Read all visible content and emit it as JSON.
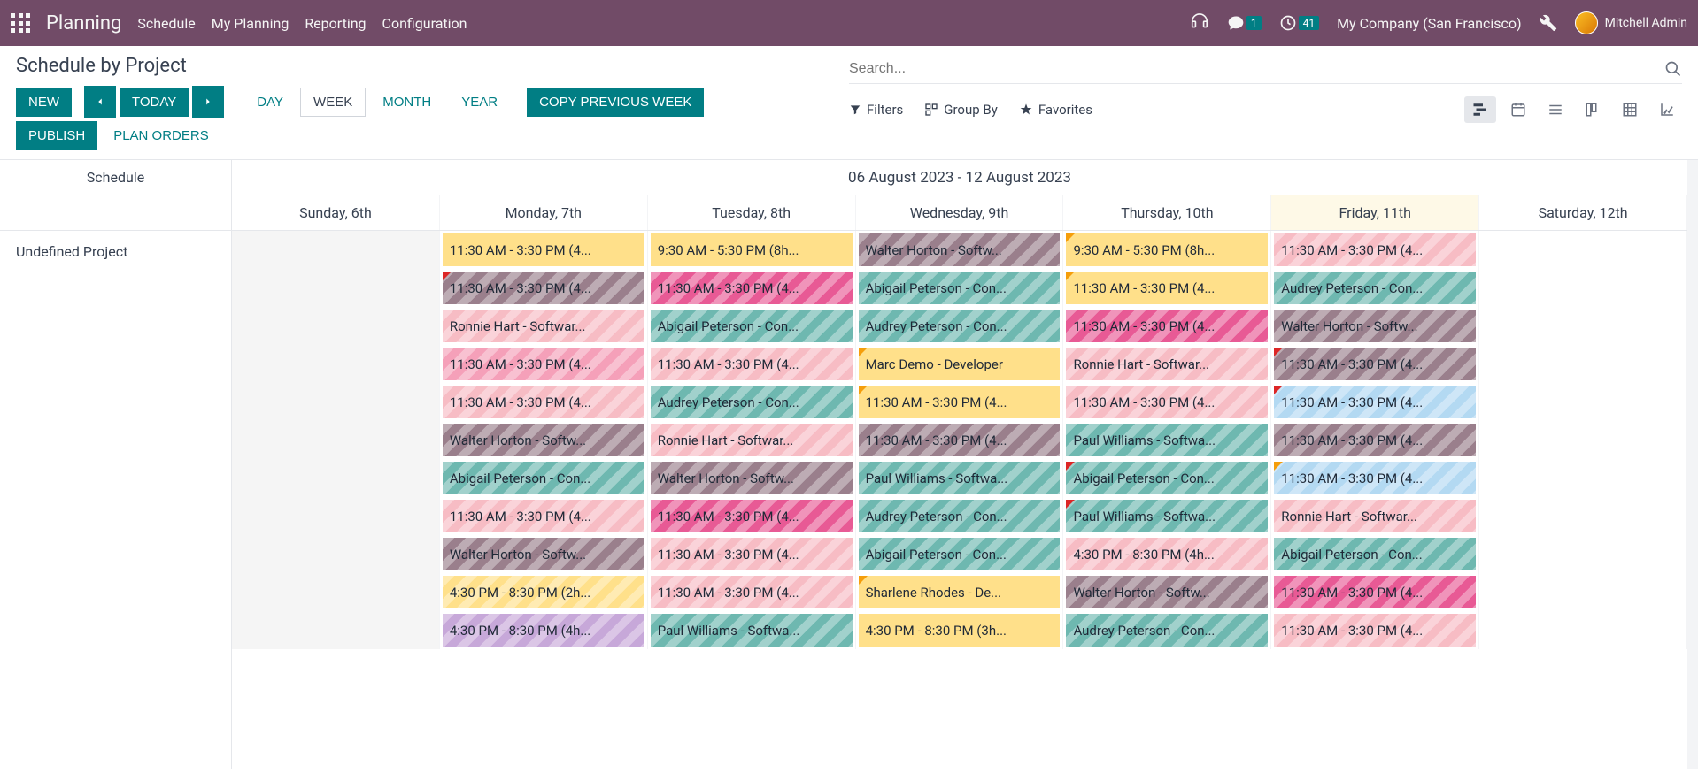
{
  "topbar": {
    "app_name": "Planning",
    "nav_items": [
      "Schedule",
      "My Planning",
      "Reporting",
      "Configuration"
    ],
    "badge_msg": "1",
    "badge_activity": "41",
    "company": "My Company (San Francisco)",
    "user_name": "Mitchell Admin"
  },
  "control": {
    "title": "Schedule by Project",
    "btn_new": "NEW",
    "btn_today": "TODAY",
    "btn_day": "DAY",
    "btn_week": "WEEK",
    "btn_month": "MONTH",
    "btn_year": "YEAR",
    "btn_copy": "COPY PREVIOUS WEEK",
    "btn_publish": "PUBLISH",
    "btn_plan": "PLAN ORDERS",
    "search_placeholder": "Search...",
    "filters": "Filters",
    "groupby": "Group By",
    "favorites": "Favorites"
  },
  "planner": {
    "side_header": "Schedule",
    "row_label": "Undefined Project",
    "date_range": "06 August 2023 - 12 August 2023",
    "days": [
      {
        "label": "Sunday, 6th",
        "past": true,
        "today": false,
        "slots": []
      },
      {
        "label": "Monday, 7th",
        "past": false,
        "today": false,
        "slots": [
          {
            "text": "11:30 AM - 3:30 PM (4...",
            "color": "c-yellow",
            "striped": false,
            "corner": null
          },
          {
            "text": "11:30 AM - 3:30 PM (4...",
            "color": "c-mauve",
            "striped": true,
            "corner": "corner-red"
          },
          {
            "text": "Ronnie Hart - Softwar...",
            "color": "c-pinklight",
            "striped": true,
            "corner": null
          },
          {
            "text": "11:30 AM - 3:30 PM (4...",
            "color": "c-pink",
            "striped": true,
            "corner": null
          },
          {
            "text": "11:30 AM - 3:30 PM (4...",
            "color": "c-pinklight",
            "striped": true,
            "corner": null
          },
          {
            "text": "Walter Horton - Softw...",
            "color": "c-mauve",
            "striped": true,
            "corner": null
          },
          {
            "text": "Abigail Peterson - Con...",
            "color": "c-teal",
            "striped": true,
            "corner": null
          },
          {
            "text": "11:30 AM - 3:30 PM (4...",
            "color": "c-pinklight",
            "striped": true,
            "corner": null
          },
          {
            "text": "Walter Horton - Softw...",
            "color": "c-mauve",
            "striped": true,
            "corner": null
          },
          {
            "text": "4:30 PM - 8:30 PM (2h...",
            "color": "c-yellow",
            "striped": true,
            "corner": null
          },
          {
            "text": "4:30 PM - 8:30 PM (4h...",
            "color": "c-purple",
            "striped": true,
            "corner": null
          }
        ]
      },
      {
        "label": "Tuesday, 8th",
        "past": false,
        "today": false,
        "slots": [
          {
            "text": "9:30 AM - 5:30 PM (8h...",
            "color": "c-yellow",
            "striped": false,
            "corner": null
          },
          {
            "text": "11:30 AM - 3:30 PM (4...",
            "color": "c-magenta",
            "striped": true,
            "corner": null
          },
          {
            "text": "Abigail Peterson - Con...",
            "color": "c-teal",
            "striped": true,
            "corner": null
          },
          {
            "text": "11:30 AM - 3:30 PM (4...",
            "color": "c-pinklight",
            "striped": true,
            "corner": null
          },
          {
            "text": "Audrey Peterson - Con...",
            "color": "c-teal",
            "striped": true,
            "corner": null
          },
          {
            "text": "Ronnie Hart - Softwar...",
            "color": "c-pinklight",
            "striped": true,
            "corner": null
          },
          {
            "text": "Walter Horton - Softw...",
            "color": "c-mauve",
            "striped": true,
            "corner": null
          },
          {
            "text": "11:30 AM - 3:30 PM (4...",
            "color": "c-magenta",
            "striped": true,
            "corner": null
          },
          {
            "text": "11:30 AM - 3:30 PM (4...",
            "color": "c-pinklight",
            "striped": true,
            "corner": null
          },
          {
            "text": "11:30 AM - 3:30 PM (4...",
            "color": "c-pinklight",
            "striped": true,
            "corner": null
          },
          {
            "text": "Paul Williams - Softwa...",
            "color": "c-teal",
            "striped": true,
            "corner": null
          }
        ]
      },
      {
        "label": "Wednesday, 9th",
        "past": false,
        "today": false,
        "slots": [
          {
            "text": "Walter Horton - Softw...",
            "color": "c-mauve",
            "striped": true,
            "corner": null
          },
          {
            "text": "Abigail Peterson - Con...",
            "color": "c-teal",
            "striped": true,
            "corner": null
          },
          {
            "text": "Audrey Peterson - Con...",
            "color": "c-teal",
            "striped": true,
            "corner": null
          },
          {
            "text": "Marc Demo - Developer",
            "color": "c-yellow",
            "striped": false,
            "corner": "corner-yellow"
          },
          {
            "text": "11:30 AM - 3:30 PM (4...",
            "color": "c-yellow",
            "striped": false,
            "corner": "corner-yellow"
          },
          {
            "text": "11:30 AM - 3:30 PM (4...",
            "color": "c-mauve",
            "striped": true,
            "corner": null
          },
          {
            "text": "Paul Williams - Softwa...",
            "color": "c-teal",
            "striped": true,
            "corner": null
          },
          {
            "text": "Audrey Peterson - Con...",
            "color": "c-teal",
            "striped": true,
            "corner": null
          },
          {
            "text": "Abigail Peterson - Con...",
            "color": "c-teal",
            "striped": true,
            "corner": null
          },
          {
            "text": "Sharlene Rhodes - De...",
            "color": "c-yellow",
            "striped": false,
            "corner": "corner-yellow"
          },
          {
            "text": "4:30 PM - 8:30 PM (3h...",
            "color": "c-yellow",
            "striped": false,
            "corner": null
          }
        ]
      },
      {
        "label": "Thursday, 10th",
        "past": false,
        "today": false,
        "slots": [
          {
            "text": "9:30 AM - 5:30 PM (8h...",
            "color": "c-yellow",
            "striped": false,
            "corner": "corner-yellow"
          },
          {
            "text": "11:30 AM - 3:30 PM (4...",
            "color": "c-yellow",
            "striped": false,
            "corner": "corner-yellow"
          },
          {
            "text": "11:30 AM - 3:30 PM (4...",
            "color": "c-magenta",
            "striped": true,
            "corner": null
          },
          {
            "text": "Ronnie Hart - Softwar...",
            "color": "c-pinklight",
            "striped": true,
            "corner": null
          },
          {
            "text": "11:30 AM - 3:30 PM (4...",
            "color": "c-pinklight",
            "striped": true,
            "corner": null
          },
          {
            "text": "Paul Williams - Softwa...",
            "color": "c-teal",
            "striped": true,
            "corner": null
          },
          {
            "text": "Abigail Peterson - Con...",
            "color": "c-teal",
            "striped": true,
            "corner": "corner-red"
          },
          {
            "text": "Paul Williams - Softwa...",
            "color": "c-teal",
            "striped": true,
            "corner": "corner-red"
          },
          {
            "text": "4:30 PM - 8:30 PM (4h...",
            "color": "c-pinklight",
            "striped": true,
            "corner": null
          },
          {
            "text": "Walter Horton - Softw...",
            "color": "c-mauve",
            "striped": true,
            "corner": null
          },
          {
            "text": "Audrey Peterson - Con...",
            "color": "c-teal",
            "striped": true,
            "corner": null
          }
        ]
      },
      {
        "label": "Friday, 11th",
        "past": false,
        "today": true,
        "slots": [
          {
            "text": "11:30 AM - 3:30 PM (4...",
            "color": "c-pinklight",
            "striped": true,
            "corner": null
          },
          {
            "text": "Audrey Peterson - Con...",
            "color": "c-teal",
            "striped": true,
            "corner": null
          },
          {
            "text": "Walter Horton - Softw...",
            "color": "c-mauve",
            "striped": true,
            "corner": null
          },
          {
            "text": "11:30 AM - 3:30 PM (4...",
            "color": "c-mauve",
            "striped": true,
            "corner": "corner-red"
          },
          {
            "text": "11:30 AM - 3:30 PM (4...",
            "color": "c-blue",
            "striped": true,
            "corner": "corner-red"
          },
          {
            "text": "11:30 AM - 3:30 PM (4...",
            "color": "c-mauve",
            "striped": true,
            "corner": null
          },
          {
            "text": "11:30 AM - 3:30 PM (4...",
            "color": "c-blue",
            "striped": true,
            "corner": "corner-yellow"
          },
          {
            "text": "Ronnie Hart - Softwar...",
            "color": "c-pinklight",
            "striped": true,
            "corner": null
          },
          {
            "text": "Abigail Peterson - Con...",
            "color": "c-teal",
            "striped": true,
            "corner": null
          },
          {
            "text": "11:30 AM - 3:30 PM (4...",
            "color": "c-magenta",
            "striped": true,
            "corner": null
          },
          {
            "text": "11:30 AM - 3:30 PM (4...",
            "color": "c-pinklight",
            "striped": true,
            "corner": null
          }
        ]
      },
      {
        "label": "Saturday, 12th",
        "past": false,
        "today": false,
        "slots": []
      }
    ]
  }
}
